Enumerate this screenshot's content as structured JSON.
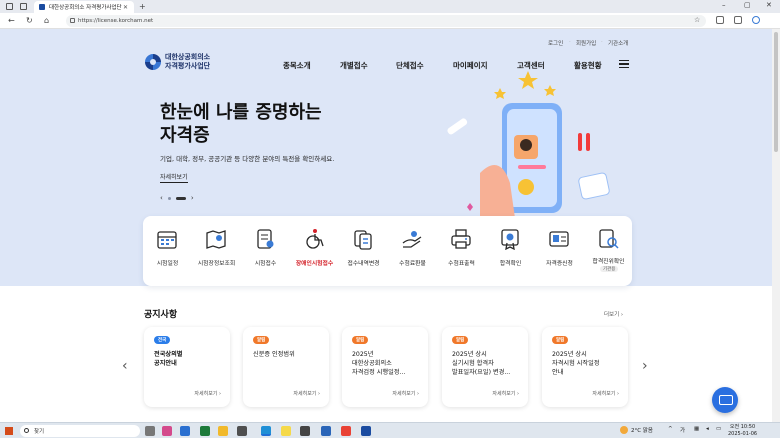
{
  "browser": {
    "tab_title": "대한상공회의소 자격평가사업단",
    "url": "https://license.korcham.net"
  },
  "site": {
    "util_links": [
      "로그인",
      "회원가입",
      "기관소개"
    ],
    "logo_line1": "대한상공회의소",
    "logo_line2": "자격평가사업단",
    "gnb": [
      "종목소개",
      "개별접수",
      "단체접수",
      "마이페이지",
      "고객센터",
      "활용현황"
    ]
  },
  "hero": {
    "title_line1": "한눈에 나를 증명하는",
    "title_line2": "자격증",
    "desc": "기업, 대학, 정부, 공공기관 등 다양한 분야의 특전을 확인하세요.",
    "more": "자세히보기"
  },
  "services": [
    {
      "label": "시험일정",
      "icon": "calendar-icon"
    },
    {
      "label": "시험장정보조회",
      "icon": "map-icon"
    },
    {
      "label": "시험접수",
      "icon": "document-edit-icon"
    },
    {
      "label": "장애인시험접수",
      "icon": "wheelchair-icon",
      "highlight": true
    },
    {
      "label": "접수내역변경",
      "icon": "file-change-icon"
    },
    {
      "label": "수험료환불",
      "icon": "refund-icon"
    },
    {
      "label": "수험표출력",
      "icon": "printer-icon"
    },
    {
      "label": "합격확인",
      "icon": "certificate-icon"
    },
    {
      "label": "자격증신청",
      "icon": "id-card-icon"
    },
    {
      "label": "합격진위확인",
      "icon": "verify-icon",
      "badge": "기관용"
    }
  ],
  "notice": {
    "title": "공지사항",
    "more": "더보기",
    "item_more": "자세히보기",
    "cards": [
      {
        "tag": "전국",
        "tag_color": "#2b7de9",
        "title": "전국상의별\n공지안내",
        "bold": true
      },
      {
        "tag": "알림",
        "tag_color": "#f0782a",
        "title": "신분증 인정범위",
        "bold": false
      },
      {
        "tag": "알림",
        "tag_color": "#f0782a",
        "title": "2025년\n대한상공회의소\n자격검정 시행일정...",
        "bold": false
      },
      {
        "tag": "알림",
        "tag_color": "#f0782a",
        "title": "2025년 상시\n실기시험 합격자\n발표일자(요일) 변경...",
        "bold": false
      },
      {
        "tag": "알림",
        "tag_color": "#f0782a",
        "title": "2025년 상시\n자격시험 시작일정\n안내",
        "bold": false
      }
    ]
  },
  "taskbar": {
    "search_placeholder": "찾기",
    "weather": "2°C 맑음",
    "time": "오전 10:50",
    "date": "2025-01-06"
  }
}
